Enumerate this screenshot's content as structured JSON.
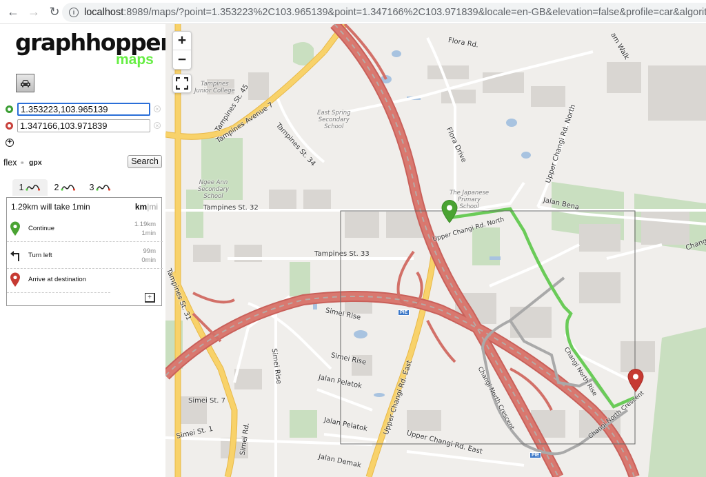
{
  "browser": {
    "url_host": "localhost",
    "url_rest": ":8989/maps/?point=1.353223%2C103.965139&point=1.347166%2C103.971839&locale=en-GB&elevation=false&profile=car&algorithm=alternative_r",
    "back_icon": "arrow-left-icon",
    "forward_icon": "arrow-right-icon",
    "reload_icon": "reload-icon",
    "info_icon": "info-icon"
  },
  "sidebar": {
    "logo_text": "graphhopper",
    "logo_sub": "maps",
    "vehicle": {
      "label": "car",
      "icon": "car-icon",
      "selected": true
    },
    "points": [
      {
        "value": "1.353223,103.965139",
        "marker_color": "#3b9e34",
        "role": "start"
      },
      {
        "value": "1.347166,103.971839",
        "marker_color": "#c9423d",
        "role": "destination"
      }
    ],
    "add_point_icon": "plus-circle-icon",
    "flex_label": "flex",
    "gpx_label": "gpx",
    "search_label": "Search",
    "alternatives": [
      {
        "label": "1",
        "active": true
      },
      {
        "label": "2",
        "active": false
      },
      {
        "label": "3",
        "active": false
      }
    ],
    "route": {
      "summary": "1.29km will take 1min",
      "unit_km": "km",
      "unit_sep": "|",
      "unit_mi": "mi",
      "instructions": [
        {
          "icon": "start-marker-icon",
          "text": "Continue",
          "distance": "1.19km",
          "time": "1min"
        },
        {
          "icon": "turn-left-icon",
          "text": "Turn left",
          "distance": "99m",
          "time": "0min"
        },
        {
          "icon": "destination-marker-icon",
          "text": "Arrive at destination",
          "distance": "",
          "time": ""
        }
      ],
      "expand_label": "+"
    }
  },
  "map": {
    "zoom_in": "+",
    "zoom_out": "−",
    "route_color": "#6acb58",
    "alt_route_color": "#a9a9a9",
    "highway_color": "#d16e66",
    "primary_road_color": "#f8d26a",
    "shield_label": "PIE",
    "labels": {
      "tampines_st45": "Tampines St. 45",
      "tampines_ave7": "Tampines Avenue 7",
      "tampines_jc": "Tampines\nJunior College",
      "east_spring": "East Spring\nSecondary\nSchool",
      "tampines_st34": "Tampines St. 34",
      "ngee_ann": "Ngee Ann\nSecondary\nSchool",
      "tampines_st32": "Tampines St. 32",
      "tampines_st33": "Tampines St. 33",
      "tampines_st31": "Tampines St. 31",
      "flora_rd": "Flora Rd.",
      "flora_drive": "Flora Drive",
      "japanese_school": "The Japanese\nPrimary\nSchool",
      "upper_changi_north": "Upper Changi Rd. North",
      "jalan_bena": "Jalan Bena",
      "upper_changi_north_rd": "Upper Changi Rd. North",
      "changi_north_rise": "Changi North Rise",
      "changi_north_crescent": "Changi North Crescent",
      "changi_north_crescent2": "Changi North Crescent",
      "simei_rise": "Simei Rise",
      "simei_rise2": "Simei Rise",
      "simei_rise3": "Simei Rise",
      "simei_st7": "Simei St. 7",
      "simei_st1": "Simei St. 1",
      "simei_rd": "Simei Rd.",
      "jalan_pelatok": "Jalan Pelatok",
      "jalan_pelatok2": "Jalan Pelatok",
      "jalan_demak": "Jalan Demak",
      "upper_changi_east": "Upper Changi Rd. East",
      "upper_changi_east2": "Upper Changi Rd. East",
      "walk": "am Walk",
      "chang": "Chang"
    }
  }
}
